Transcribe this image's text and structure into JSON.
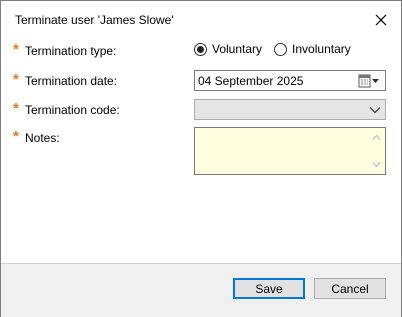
{
  "dialog": {
    "title": "Terminate user 'James Slowe'"
  },
  "form": {
    "termination_type": {
      "label": "Termination type:",
      "required_mark": "*",
      "options": [
        {
          "label": "Voluntary",
          "selected": true
        },
        {
          "label": "Involuntary",
          "selected": false
        }
      ]
    },
    "termination_date": {
      "label": "Termination date:",
      "required_mark": "*",
      "value": "04 September 2025"
    },
    "termination_code": {
      "label": "Termination code:",
      "required_mark": "*",
      "value": ""
    },
    "notes": {
      "label": "Notes:",
      "required_mark": "*",
      "value": ""
    }
  },
  "buttons": {
    "save": "Save",
    "cancel": "Cancel"
  },
  "colors": {
    "required": "#e07a1f",
    "notes_background": "#ffffe0",
    "default_button_border": "#0078d7"
  },
  "icons": {
    "close": "close-icon",
    "calendar": "calendar-icon",
    "dropdown": "chevron-down-icon"
  }
}
